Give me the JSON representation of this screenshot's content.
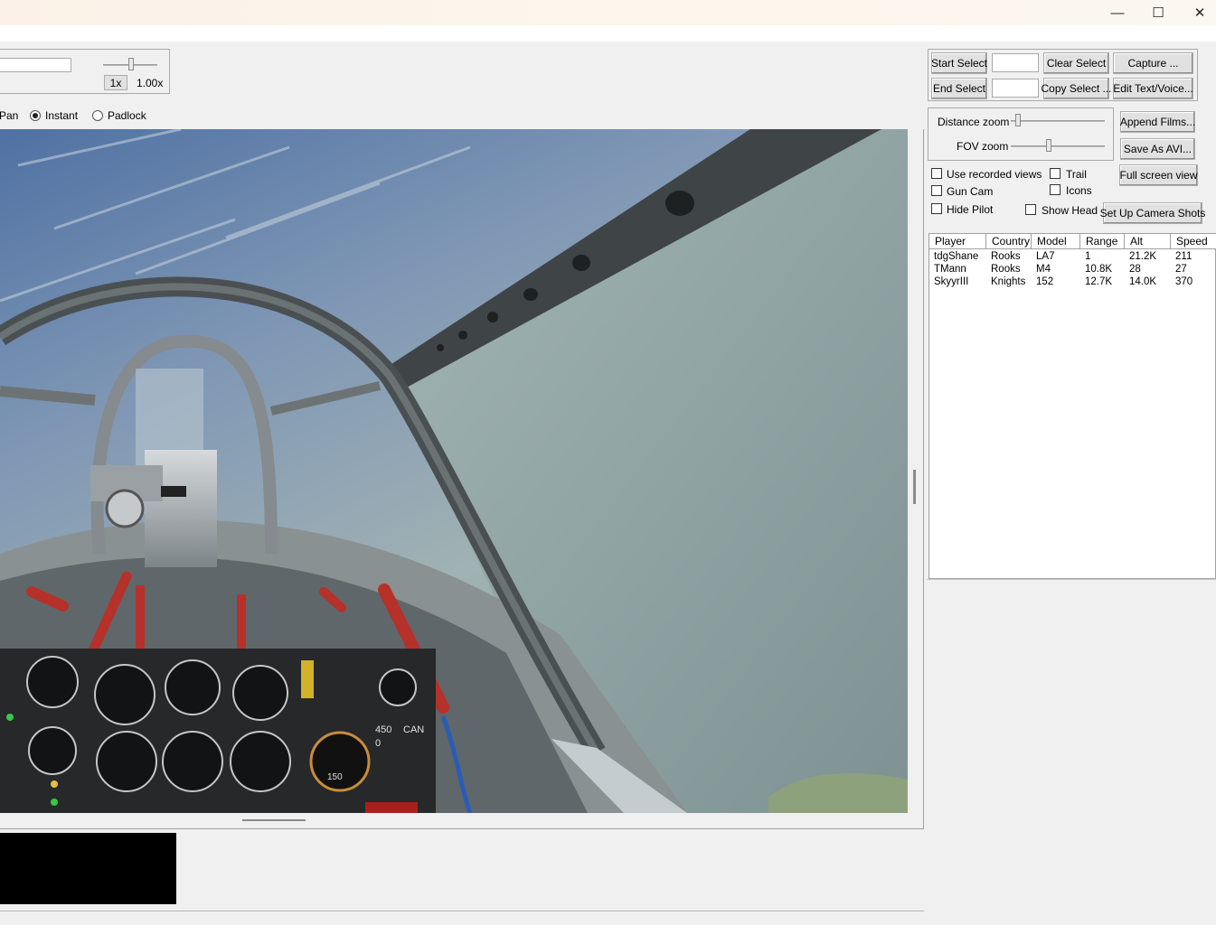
{
  "window": {
    "controls": {
      "minimize": "—",
      "maximize": "☐",
      "close": "✕"
    }
  },
  "playback": {
    "speed_button": "1x",
    "speed_value": "1.00x"
  },
  "view_mode": {
    "pan_label": "Pan",
    "instant_label": "Instant",
    "padlock_label": "Padlock",
    "selected": "Instant"
  },
  "selection": {
    "start_select": "Start Select",
    "end_select": "End Select",
    "start_value": "",
    "end_value": "",
    "clear_select": "Clear Select",
    "copy_select": "Copy Select ...",
    "capture": "Capture ...",
    "edit_text_voice": "Edit Text/Voice..."
  },
  "zoom": {
    "distance_label": "Distance zoom",
    "fov_label": "FOV zoom",
    "distance_level": 0.05,
    "fov_level": 0.4
  },
  "film_buttons": {
    "append_films": "Append Films...",
    "save_as_avi": "Save As AVI...",
    "full_screen": "Full screen view",
    "setup_camera": "Set Up Camera Shots"
  },
  "options": {
    "use_recorded_views": "Use recorded views",
    "gun_cam": "Gun Cam",
    "hide_pilot": "Hide Pilot",
    "trail": "Trail",
    "icons": "Icons",
    "show_head": "Show Head"
  },
  "cockpit_hud": {
    "ammo_a": "450",
    "ammo_b": "0",
    "weapon": "CAN",
    "gauge_value": "150"
  },
  "players": {
    "columns": [
      "Player",
      "Country",
      "Model",
      "Range",
      "Alt",
      "Speed"
    ],
    "rows": [
      [
        "tdgShane",
        "Rooks",
        "LA7",
        "1",
        "21.2K",
        "211"
      ],
      [
        "TMann",
        "Rooks",
        "M4",
        "10.8K",
        "28",
        "27"
      ],
      [
        "SkyyrIII",
        "Knights",
        "152",
        "12.7K",
        "14.0K",
        "370"
      ]
    ]
  },
  "colors": {
    "window_bg": "#f0f0f0",
    "sky_top": "#5a7aa8",
    "sky_haze": "#a2b4b4",
    "frame": "#555555",
    "handle_red": "#c0302a"
  }
}
